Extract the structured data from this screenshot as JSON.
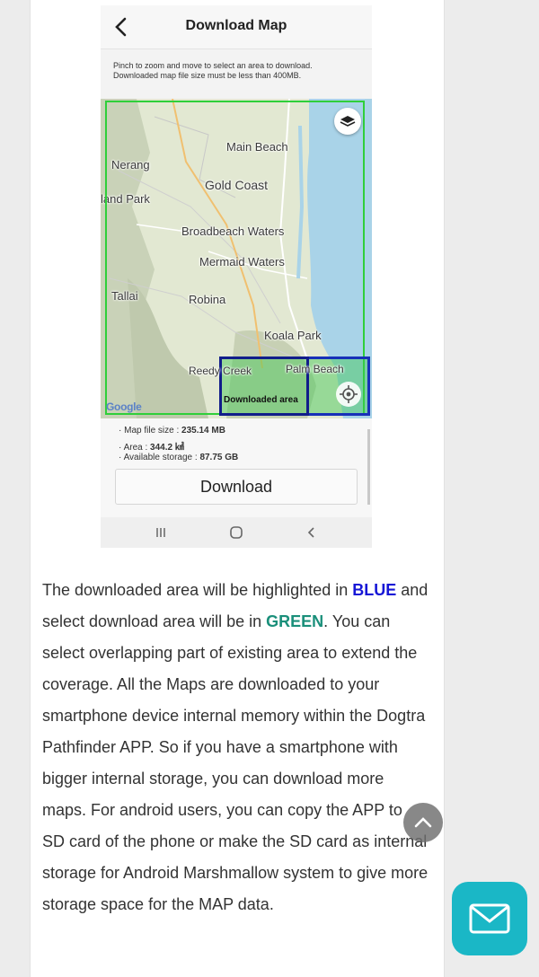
{
  "app": {
    "title": "Download Map",
    "instructions": [
      "Pinch to zoom and move to select an area to download.",
      "Downloaded map file size must be less than 400MB."
    ]
  },
  "map": {
    "places": {
      "main_beach": "Main Beach",
      "nerang": "Nerang",
      "land_park": "land Park",
      "gold_coast": "Gold Coast",
      "broadbeach": "Broadbeach Waters",
      "mermaid": "Mermaid Waters",
      "tallai": "Tallai",
      "robina": "Robina",
      "koala_park": "Koala Park",
      "reedy_creek": "Reedy Creek",
      "palm_beach": "Palm Beach"
    },
    "downloaded_label": "Downloaded area",
    "google_logo": "Google",
    "highlight_colors": {
      "downloaded": "#1730b8",
      "selected": "#2fcf3a"
    }
  },
  "info": {
    "file_size_label": "Map file size : ",
    "file_size_value": "235.14 MB",
    "area_label": "Area : ",
    "area_value": "344.2 ㎢",
    "storage_label": "Available storage : ",
    "storage_value": "87.75 GB",
    "download_button": "Download"
  },
  "article": {
    "part1": "The downloaded area will be highlighted in ",
    "blue_word": "BLUE",
    "part2": " and select download area will be in ",
    "green_word": "GREEN",
    "part3": ". You can select overlapping part of existing area to extend the coverage. All the Maps are downloaded to your smartphone device internal memory within the Dogtra Pathfinder APP. So if you have a smartphone with bigger internal storage, you can download more maps. For android users, you can copy the APP to SD card of the phone or make the SD card as internal storage for Android Marshmallow system to give more storage space for the MAP data."
  },
  "icons": {
    "back": "chevron-left-icon",
    "layers": "layers-icon",
    "locate": "locate-icon",
    "scroll_top": "chevron-up-icon",
    "contact": "mail-icon"
  }
}
